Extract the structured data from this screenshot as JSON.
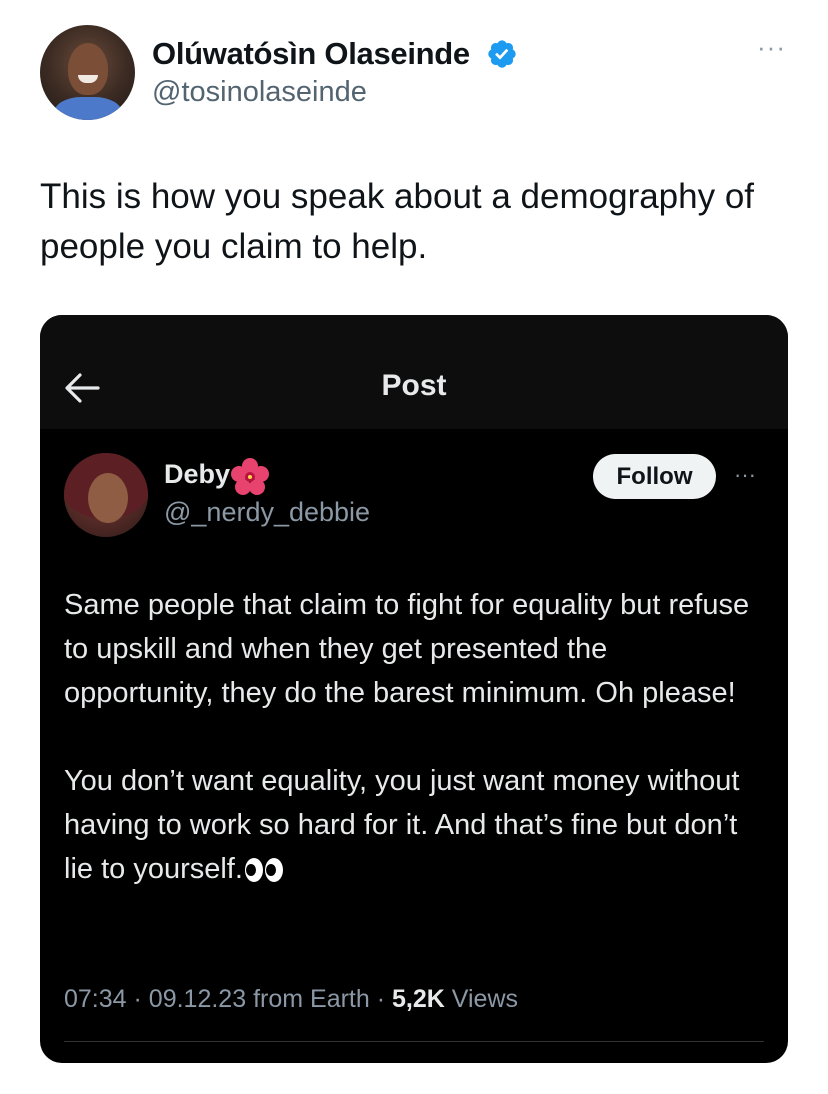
{
  "author": {
    "name": "Olúwatósìn Olaseinde",
    "handle": "@tosinolaseinde",
    "verified_color": "#1d9bf0"
  },
  "more_label": "···",
  "tweet": {
    "text": "This is how you speak about a demography of people you claim to help."
  },
  "embedded_post": {
    "header_title": "Post",
    "back_icon": "arrow-left-icon",
    "author_name": "Deby",
    "author_emoji": "hibiscus-icon",
    "author_handle": "@_nerdy_debbie",
    "follow_label": "Follow",
    "more_label": "···",
    "paragraph_1": "Same people that claim to fight for equality but refuse to upskill and when they get presented the opportunity, they do the barest minimum. Oh please!",
    "paragraph_2": "You don’t want equality, you just want money without having to work so hard for it. And that’s fine but don’t lie to yourself.",
    "end_emoji": "eyes-icon",
    "time": "07:34",
    "date": "09.12.23",
    "source": "from Earth",
    "views_count": "5,2K",
    "views_label": "Views",
    "separator": "·"
  }
}
